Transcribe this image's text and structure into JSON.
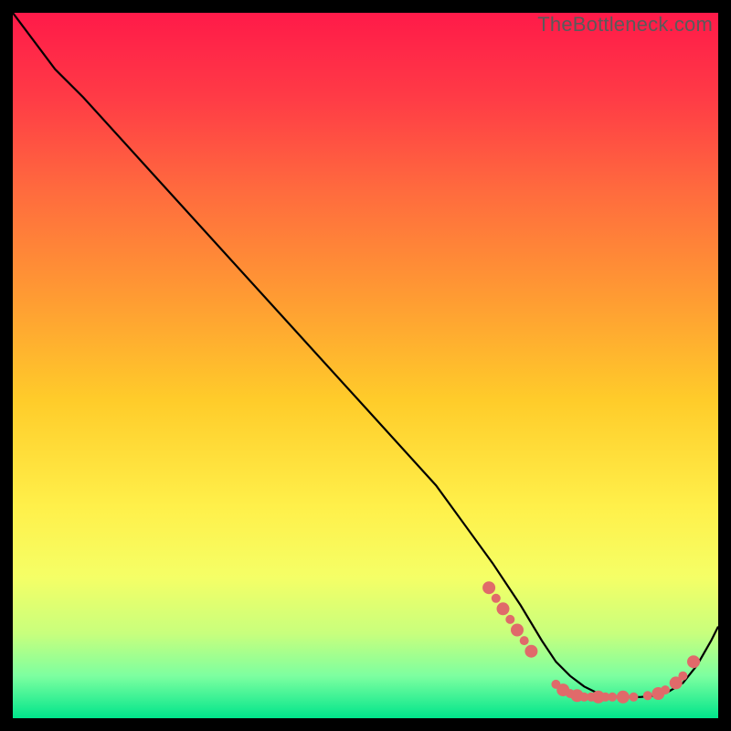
{
  "watermark": "TheBottleneck.com",
  "chart_data": {
    "type": "line",
    "title": "",
    "xlabel": "",
    "ylabel": "",
    "xlim": [
      0,
      100
    ],
    "ylim": [
      0,
      100
    ],
    "grid": false,
    "legend": false,
    "background_gradient": {
      "stops": [
        {
          "pos": 0.0,
          "color": "#ff1a49"
        },
        {
          "pos": 0.12,
          "color": "#ff3b46"
        },
        {
          "pos": 0.25,
          "color": "#ff6a3e"
        },
        {
          "pos": 0.4,
          "color": "#ff9a33"
        },
        {
          "pos": 0.55,
          "color": "#ffcc2a"
        },
        {
          "pos": 0.7,
          "color": "#fff04a"
        },
        {
          "pos": 0.8,
          "color": "#f5ff66"
        },
        {
          "pos": 0.88,
          "color": "#c8ff7d"
        },
        {
          "pos": 0.94,
          "color": "#7dffa0"
        },
        {
          "pos": 1.0,
          "color": "#00e58b"
        }
      ]
    },
    "series": [
      {
        "name": "curve",
        "color": "#000000",
        "x": [
          0,
          6,
          10,
          20,
          30,
          40,
          50,
          60,
          68,
          72,
          75,
          77,
          79,
          81,
          83,
          85,
          87,
          89,
          91,
          93,
          95,
          97,
          99,
          100
        ],
        "y": [
          100,
          92,
          88,
          77,
          66,
          55,
          44,
          33,
          22,
          16,
          11,
          8,
          6,
          4.5,
          3.5,
          3,
          3,
          3,
          3.2,
          3.8,
          5,
          7.5,
          11,
          13
        ]
      }
    ],
    "markers": {
      "name": "highlight-points",
      "color": "#e06a6a",
      "radius_small": 5,
      "radius_large": 7,
      "points": [
        {
          "x": 67.5,
          "y": 18.5,
          "r": "large"
        },
        {
          "x": 68.5,
          "y": 17.0,
          "r": "small"
        },
        {
          "x": 69.5,
          "y": 15.5,
          "r": "large"
        },
        {
          "x": 70.5,
          "y": 14.0,
          "r": "small"
        },
        {
          "x": 71.5,
          "y": 12.5,
          "r": "large"
        },
        {
          "x": 72.5,
          "y": 11.0,
          "r": "small"
        },
        {
          "x": 73.5,
          "y": 9.5,
          "r": "large"
        },
        {
          "x": 77.0,
          "y": 4.8,
          "r": "small"
        },
        {
          "x": 78.0,
          "y": 4.0,
          "r": "large"
        },
        {
          "x": 79.0,
          "y": 3.5,
          "r": "small"
        },
        {
          "x": 80.0,
          "y": 3.2,
          "r": "large"
        },
        {
          "x": 81.0,
          "y": 3.0,
          "r": "small"
        },
        {
          "x": 82.0,
          "y": 3.0,
          "r": "small"
        },
        {
          "x": 83.0,
          "y": 3.0,
          "r": "large"
        },
        {
          "x": 84.0,
          "y": 3.0,
          "r": "small"
        },
        {
          "x": 85.0,
          "y": 3.0,
          "r": "small"
        },
        {
          "x": 86.5,
          "y": 3.0,
          "r": "large"
        },
        {
          "x": 88.0,
          "y": 3.0,
          "r": "small"
        },
        {
          "x": 90.0,
          "y": 3.2,
          "r": "small"
        },
        {
          "x": 91.5,
          "y": 3.5,
          "r": "large"
        },
        {
          "x": 92.5,
          "y": 4.0,
          "r": "small"
        },
        {
          "x": 94.0,
          "y": 5.0,
          "r": "large"
        },
        {
          "x": 95.0,
          "y": 6.0,
          "r": "small"
        },
        {
          "x": 96.5,
          "y": 8.0,
          "r": "large"
        }
      ]
    }
  }
}
